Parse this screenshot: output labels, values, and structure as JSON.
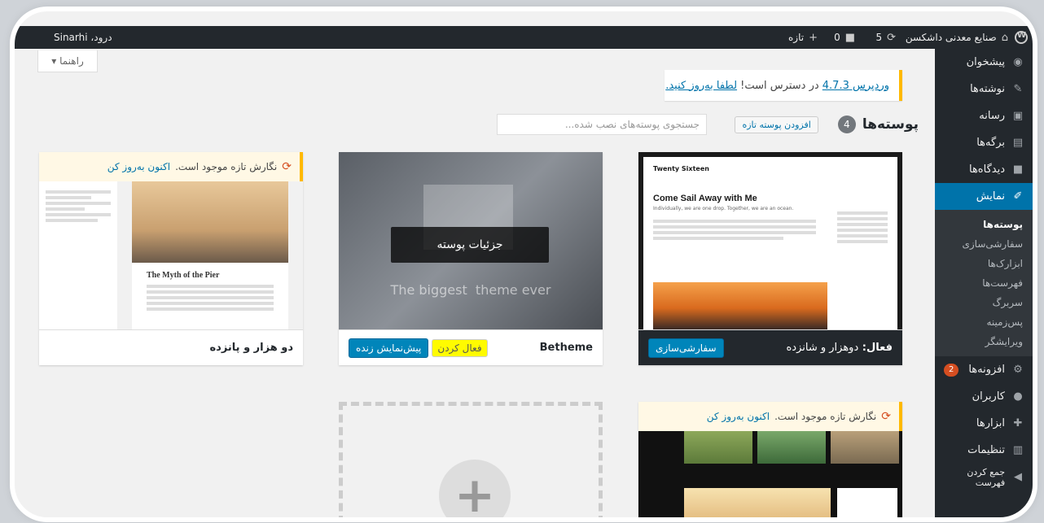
{
  "adminbar": {
    "site_name": "صنایع معدنی داشکسن",
    "updates_count": "5",
    "comments_count": "0",
    "new_label": "تازه",
    "user_greeting": "درود، Sinarhi"
  },
  "sidebar": {
    "items": [
      {
        "label": "پیشخوان"
      },
      {
        "label": "نوشته‌ها"
      },
      {
        "label": "رسانه"
      },
      {
        "label": "برگه‌ها"
      },
      {
        "label": "دیدگاه‌ها"
      },
      {
        "label": "نمایش"
      },
      {
        "label": "افزونه‌ها"
      },
      {
        "label": "کاربران"
      },
      {
        "label": "ابزارها"
      },
      {
        "label": "تنظیمات"
      },
      {
        "label": "جمع کردن فهرست"
      }
    ],
    "submenu": [
      "پوسته‌ها",
      "سفارشی‌سازی",
      "ابزارک‌ها",
      "فهرست‌ها",
      "سربرگ",
      "پس‌زمینه",
      "ویرایشگر"
    ],
    "plugins_badge": "2"
  },
  "help_tab": "راهنما ▾",
  "notice": {
    "link1": "وردپرس 4.7.3",
    "text": " در دسترس است! ",
    "link2": "لطفا به‌روز کنید."
  },
  "header": {
    "title": "پوسته‌ها",
    "count": "4",
    "add_button": "افزودن پوسته تازه",
    "search_placeholder": "جستجوی پوسته‌های نصب شده..."
  },
  "themes": {
    "active": {
      "screenshot_title": "Twenty Sixteen",
      "screenshot_tagline": "Come Sail Away with Me",
      "screenshot_sub": "Individually, we are one drop. Together, we are an ocean.",
      "status": "فعال:",
      "name": "دوهزار و شانزده",
      "customize_button": "سفارشی‌سازی"
    },
    "betheme": {
      "name": "Betheme",
      "overlay": "جزئیات پوسته",
      "slogan": "The biggest  theme ever",
      "activate": "فعال کردن",
      "preview": "پیش‌نمایش زنده"
    },
    "fifteen": {
      "update_text": "نگارش تازه موجود است.",
      "update_link": "اکنون به‌روز کن",
      "screenshot_title": "The Myth of the Pier",
      "name": "دو هزار و پانزده"
    },
    "fourth": {
      "update_text": "نگارش تازه موجود است.",
      "update_link": "اکنون به‌روز کن"
    }
  },
  "colors": {
    "primary": "#0073aa",
    "adminbar": "#23282d",
    "notice": "#ffb900"
  }
}
